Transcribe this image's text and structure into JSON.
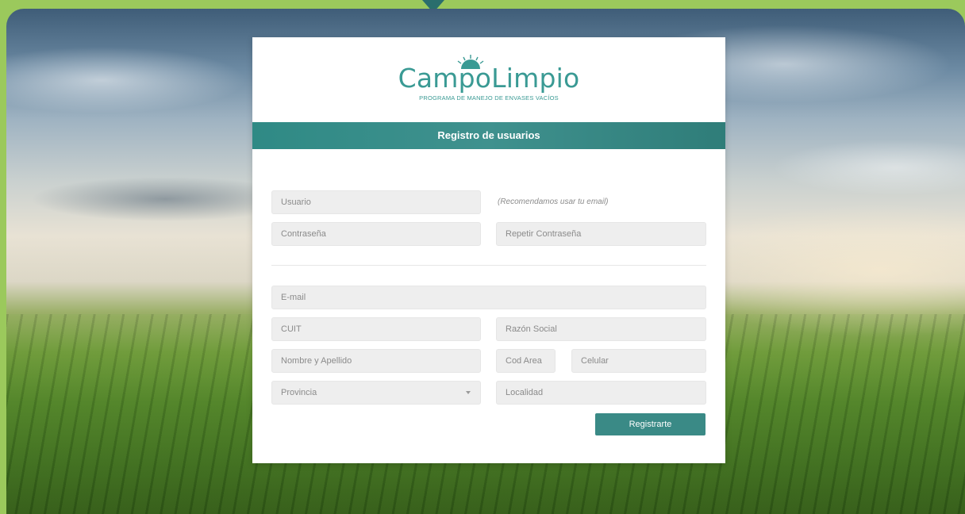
{
  "logo": {
    "wordmark": "CampoLimpio",
    "tagline": "PROGRAMA DE MANEJO DE ENVASES VACÍOS"
  },
  "header": {
    "title": "Registro de usuarios"
  },
  "form": {
    "usuario_placeholder": "Usuario",
    "usuario_hint": "(Recomendamos usar tu email)",
    "password_placeholder": "Contraseña",
    "repeat_password_placeholder": "Repetir Contraseña",
    "email_placeholder": "E-mail",
    "cuit_placeholder": "CUIT",
    "razon_social_placeholder": "Razón Social",
    "nombre_placeholder": "Nombre y Apellido",
    "cod_area_placeholder": "Cod Area",
    "celular_placeholder": "Celular",
    "provincia_selected": "Provincia",
    "localidad_placeholder": "Localidad",
    "submit_label": "Registrarte"
  },
  "colors": {
    "accent": "#3a8a86",
    "frame": "#9bc95c"
  }
}
